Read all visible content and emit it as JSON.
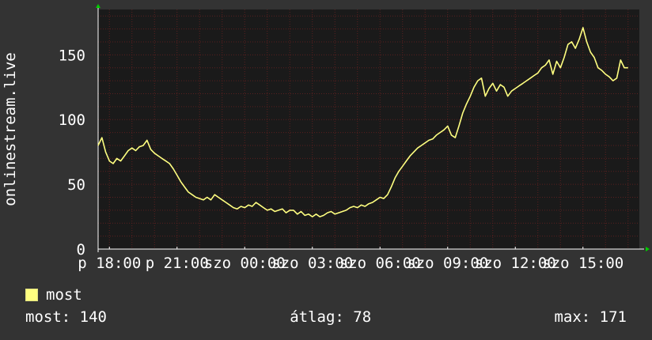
{
  "chart_data": {
    "type": "line",
    "ylabel": "onlinestream.live",
    "ylim": [
      0,
      185
    ],
    "y_ticks": [
      0,
      50,
      100,
      150
    ],
    "x_range_hours": [
      17.5,
      17.5
    ],
    "x_ticks": [
      "p 18:00",
      "p 21:00",
      "szo 00:00",
      "szo 03:00",
      "szo 06:00",
      "szo 09:00",
      "szo 12:00",
      "szo 15:00"
    ],
    "grid": true,
    "legend_position": "bottom-left",
    "series": [
      {
        "name": "most",
        "color": "#ffff80",
        "points": [
          [
            "p 17:30",
            80
          ],
          [
            "p 17:40",
            86
          ],
          [
            "p 17:50",
            75
          ],
          [
            "p 18:00",
            68
          ],
          [
            "p 18:10",
            66
          ],
          [
            "p 18:20",
            70
          ],
          [
            "p 18:30",
            68
          ],
          [
            "p 18:40",
            72
          ],
          [
            "p 18:50",
            76
          ],
          [
            "p 19:00",
            78
          ],
          [
            "p 19:10",
            76
          ],
          [
            "p 19:20",
            79
          ],
          [
            "p 19:30",
            80
          ],
          [
            "p 19:40",
            84
          ],
          [
            "p 19:50",
            77
          ],
          [
            "p 20:00",
            74
          ],
          [
            "p 20:10",
            72
          ],
          [
            "p 20:20",
            70
          ],
          [
            "p 20:30",
            68
          ],
          [
            "p 20:40",
            66
          ],
          [
            "p 20:50",
            62
          ],
          [
            "p 21:00",
            57
          ],
          [
            "p 21:10",
            52
          ],
          [
            "p 21:20",
            48
          ],
          [
            "p 21:30",
            44
          ],
          [
            "p 21:40",
            42
          ],
          [
            "p 21:50",
            40
          ],
          [
            "p 22:00",
            39
          ],
          [
            "p 22:10",
            38
          ],
          [
            "p 22:20",
            40
          ],
          [
            "p 22:30",
            38
          ],
          [
            "p 22:40",
            42
          ],
          [
            "p 22:50",
            40
          ],
          [
            "p 23:00",
            38
          ],
          [
            "p 23:10",
            36
          ],
          [
            "p 23:20",
            34
          ],
          [
            "p 23:30",
            32
          ],
          [
            "p 23:40",
            31
          ],
          [
            "p 23:50",
            33
          ],
          [
            "szo 00:00",
            32
          ],
          [
            "szo 00:10",
            34
          ],
          [
            "szo 00:20",
            33
          ],
          [
            "szo 00:30",
            36
          ],
          [
            "szo 00:40",
            34
          ],
          [
            "szo 00:50",
            32
          ],
          [
            "szo 01:00",
            30
          ],
          [
            "szo 01:10",
            31
          ],
          [
            "szo 01:20",
            29
          ],
          [
            "szo 01:30",
            30
          ],
          [
            "szo 01:40",
            31
          ],
          [
            "szo 01:50",
            28
          ],
          [
            "szo 02:00",
            30
          ],
          [
            "szo 02:10",
            30
          ],
          [
            "szo 02:20",
            27
          ],
          [
            "szo 02:30",
            29
          ],
          [
            "szo 02:40",
            26
          ],
          [
            "szo 02:50",
            27
          ],
          [
            "szo 03:00",
            25
          ],
          [
            "szo 03:10",
            27
          ],
          [
            "szo 03:20",
            25
          ],
          [
            "szo 03:30",
            26
          ],
          [
            "szo 03:40",
            28
          ],
          [
            "szo 03:50",
            29
          ],
          [
            "szo 04:00",
            27
          ],
          [
            "szo 04:10",
            28
          ],
          [
            "szo 04:20",
            29
          ],
          [
            "szo 04:30",
            30
          ],
          [
            "szo 04:40",
            32
          ],
          [
            "szo 04:50",
            33
          ],
          [
            "szo 05:00",
            32
          ],
          [
            "szo 05:10",
            34
          ],
          [
            "szo 05:20",
            33
          ],
          [
            "szo 05:30",
            35
          ],
          [
            "szo 05:40",
            36
          ],
          [
            "szo 05:50",
            38
          ],
          [
            "szo 06:00",
            40
          ],
          [
            "szo 06:10",
            39
          ],
          [
            "szo 06:20",
            42
          ],
          [
            "szo 06:30",
            48
          ],
          [
            "szo 06:40",
            55
          ],
          [
            "szo 06:50",
            60
          ],
          [
            "szo 07:00",
            64
          ],
          [
            "szo 07:10",
            68
          ],
          [
            "szo 07:20",
            72
          ],
          [
            "szo 07:30",
            75
          ],
          [
            "szo 07:40",
            78
          ],
          [
            "szo 07:50",
            80
          ],
          [
            "szo 08:00",
            82
          ],
          [
            "szo 08:10",
            84
          ],
          [
            "szo 08:20",
            85
          ],
          [
            "szo 08:30",
            88
          ],
          [
            "szo 08:40",
            90
          ],
          [
            "szo 08:50",
            92
          ],
          [
            "szo 09:00",
            95
          ],
          [
            "szo 09:10",
            88
          ],
          [
            "szo 09:20",
            86
          ],
          [
            "szo 09:30",
            95
          ],
          [
            "szo 09:40",
            105
          ],
          [
            "szo 09:50",
            112
          ],
          [
            "szo 10:00",
            118
          ],
          [
            "szo 10:10",
            125
          ],
          [
            "szo 10:20",
            130
          ],
          [
            "szo 10:30",
            132
          ],
          [
            "szo 10:40",
            118
          ],
          [
            "szo 10:50",
            124
          ],
          [
            "szo 11:00",
            128
          ],
          [
            "szo 11:10",
            122
          ],
          [
            "szo 11:20",
            127
          ],
          [
            "szo 11:30",
            125
          ],
          [
            "szo 11:40",
            118
          ],
          [
            "szo 11:50",
            122
          ],
          [
            "szo 12:00",
            124
          ],
          [
            "szo 12:10",
            126
          ],
          [
            "szo 12:20",
            128
          ],
          [
            "szo 12:30",
            130
          ],
          [
            "szo 12:40",
            132
          ],
          [
            "szo 12:50",
            134
          ],
          [
            "szo 13:00",
            136
          ],
          [
            "szo 13:10",
            140
          ],
          [
            "szo 13:20",
            142
          ],
          [
            "szo 13:30",
            146
          ],
          [
            "szo 13:40",
            135
          ],
          [
            "szo 13:50",
            145
          ],
          [
            "szo 14:00",
            140
          ],
          [
            "szo 14:10",
            148
          ],
          [
            "szo 14:20",
            158
          ],
          [
            "szo 14:30",
            160
          ],
          [
            "szo 14:40",
            155
          ],
          [
            "szo 14:50",
            162
          ],
          [
            "szo 15:00",
            171
          ],
          [
            "szo 15:10",
            160
          ],
          [
            "szo 15:20",
            152
          ],
          [
            "szo 15:30",
            148
          ],
          [
            "szo 15:40",
            140
          ],
          [
            "szo 15:50",
            138
          ],
          [
            "szo 16:00",
            135
          ],
          [
            "szo 16:10",
            133
          ],
          [
            "szo 16:20",
            130
          ],
          [
            "szo 16:30",
            132
          ],
          [
            "szo 16:40",
            146
          ],
          [
            "szo 16:50",
            140
          ],
          [
            "szo 17:00",
            140
          ]
        ]
      }
    ]
  },
  "legend": {
    "label": "most",
    "color": "#ffff80"
  },
  "stats": {
    "current": "most: 140",
    "average": "átlag: 78",
    "maximum": "max: 171"
  },
  "colors": {
    "background": "#333333",
    "plot_background": "#1a1a1a",
    "grid": "#5a1f1f",
    "axis": "#ffffff",
    "arrow": "#00cc00"
  }
}
